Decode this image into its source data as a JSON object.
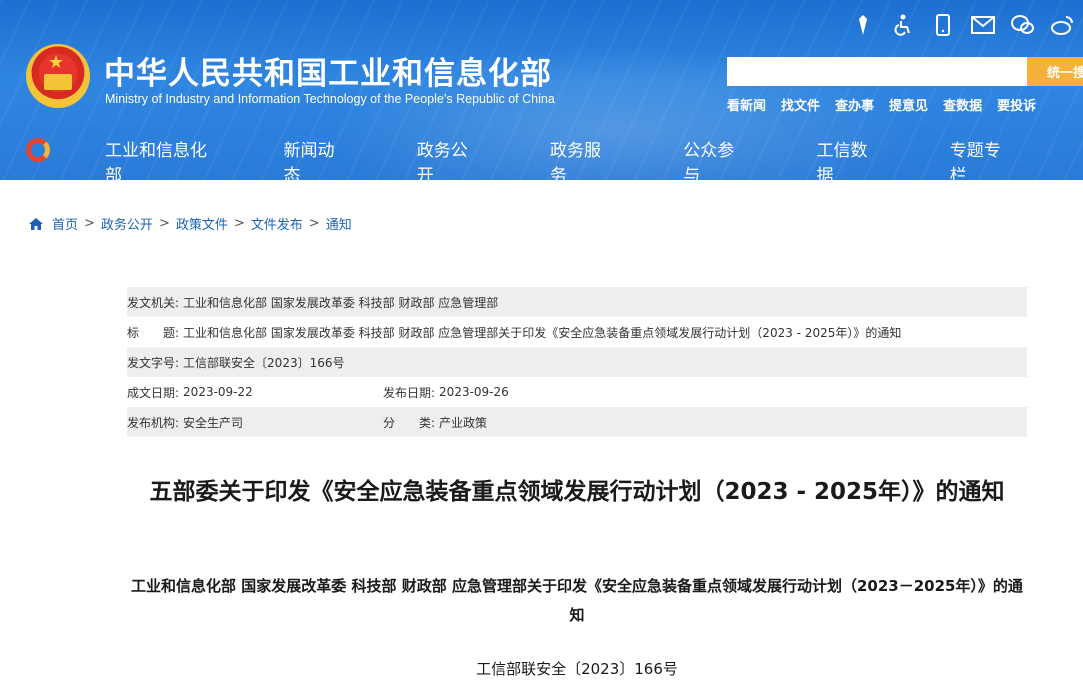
{
  "header": {
    "title_cn": "中华人民共和国工业和信息化部",
    "title_en": "Ministry of Industry and Information Technology of the People’s Republic of China",
    "icons": [
      "national-emblem-icon",
      "accessibility-icon",
      "mobile-icon",
      "mail-icon",
      "wechat-icon",
      "weibo-icon"
    ],
    "search": {
      "placeholder": "",
      "button_label": "统一搜"
    },
    "quick_links": [
      "看新闻",
      "找文件",
      "查办事",
      "提意见",
      "查数据",
      "要投诉"
    ],
    "nav": [
      "工业和信息化部",
      "新闻动态",
      "政务公开",
      "政务服务",
      "公众参与",
      "工信数据",
      "专题专栏"
    ],
    "colors": {
      "primary": "#2a7bd8",
      "accent": "#f5b23a"
    }
  },
  "breadcrumb": [
    "首页",
    "政务公开",
    "政策文件",
    "文件发布",
    "通知"
  ],
  "meta": {
    "issuer_label": "发文机关:",
    "issuer": "工业和信息化部 国家发展改革委 科技部 财政部 应急管理部",
    "title_label": "标　　题:",
    "title": "工业和信息化部 国家发展改革委 科技部 财政部 应急管理部关于印发《安全应急装备重点领域发展行动计划（2023 - 2025年）》的通知",
    "docno_label": "发文字号:",
    "docno": "工信部联安全〔2023〕166号",
    "written_label": "成文日期:",
    "written": "2023-09-22",
    "published_label": "发布日期:",
    "published": "2023-09-26",
    "org_label": "发布机构:",
    "org": "安全生产司",
    "category_label": "分　　类:",
    "category": "产业政策"
  },
  "article": {
    "title": "五部委关于印发《安全应急装备重点领域发展行动计划（2023 - 2025年）》的通知",
    "subtitle": "工业和信息化部 国家发展改革委 科技部 财政部 应急管理部关于印发《安全应急装备重点领域发展行动计划（2023－2025年）》的通知",
    "docno": "工信部联安全〔2023〕166号"
  }
}
